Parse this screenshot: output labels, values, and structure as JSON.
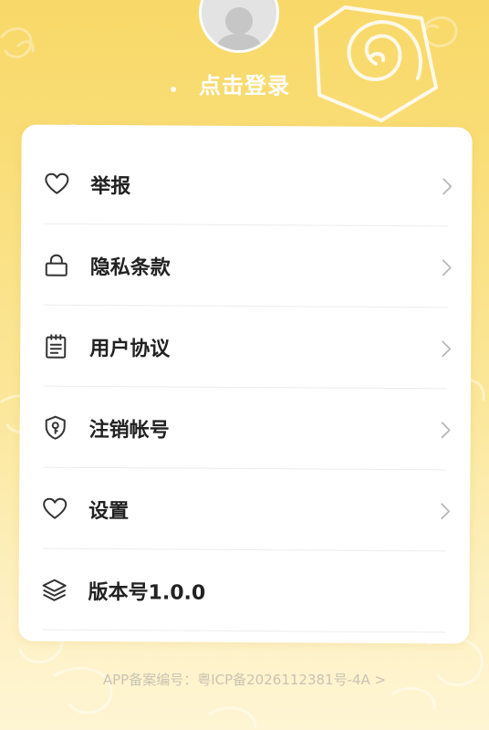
{
  "header": {
    "login_text": "点击登录"
  },
  "menu": {
    "items": [
      {
        "label": "举报",
        "icon": "heart-icon",
        "has_arrow": true
      },
      {
        "label": "隐私条款",
        "icon": "lock-icon",
        "has_arrow": true
      },
      {
        "label": "用户协议",
        "icon": "notepad-icon",
        "has_arrow": true
      },
      {
        "label": "注销帐号",
        "icon": "shield-key-icon",
        "has_arrow": true
      },
      {
        "label": "设置",
        "icon": "heart-icon",
        "has_arrow": true
      },
      {
        "label": "版本号1.0.0",
        "icon": "layers-icon",
        "has_arrow": false
      }
    ]
  },
  "footer": {
    "icp_text": "APP备案编号：粤ICP备2026112381号-4A  >"
  },
  "colors": {
    "background_top": "#f8d868",
    "background_bottom": "#fef5d4",
    "card": "#ffffff",
    "label_text": "#222222",
    "chevron": "#b8b8b8",
    "footer_text": "#c9c3b4"
  }
}
